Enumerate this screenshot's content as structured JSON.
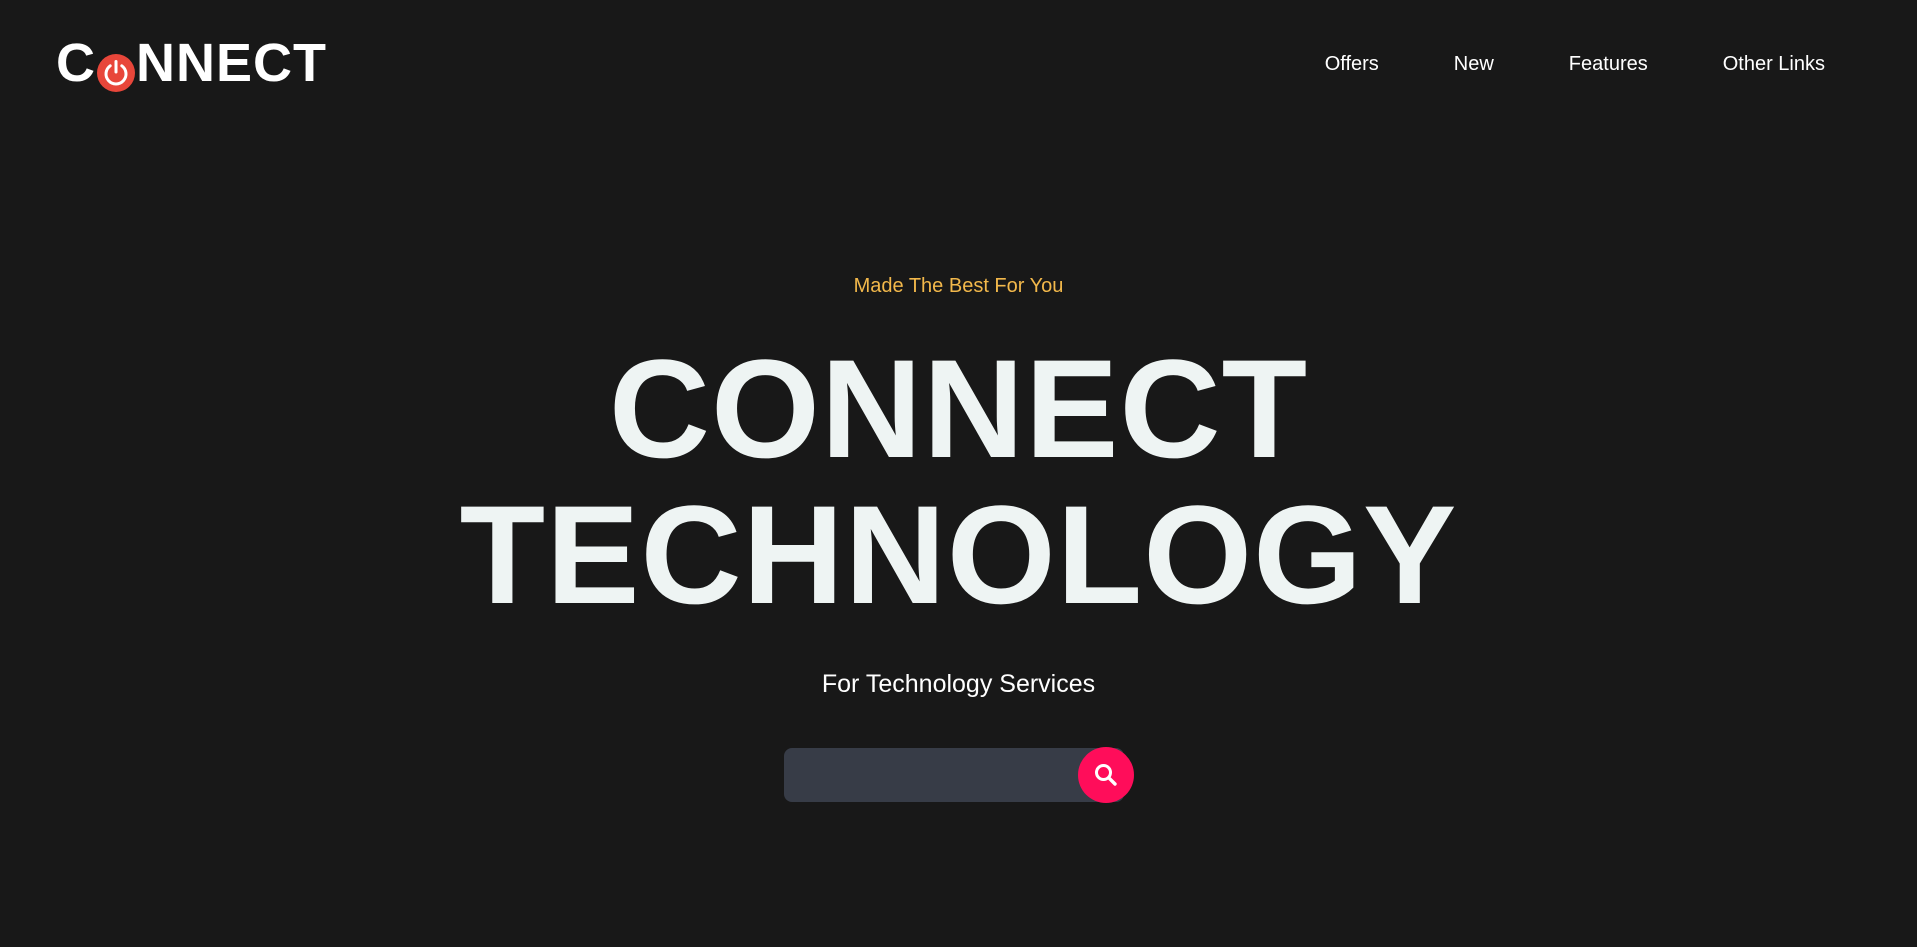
{
  "header": {
    "logo": {
      "prefix": "C",
      "suffix": "NNECT",
      "icon": "power-icon",
      "icon_color": "#e8463a"
    },
    "nav": [
      {
        "label": "Offers"
      },
      {
        "label": "New"
      },
      {
        "label": "Features"
      },
      {
        "label": "Other Links"
      }
    ]
  },
  "hero": {
    "tagline": "Made The Best For You",
    "headline_line1": "CONNECT",
    "headline_line2": "TECHNOLOGY",
    "subtitle": "For Technology Services"
  },
  "search": {
    "value": "",
    "placeholder": "",
    "button_icon": "search-icon"
  },
  "colors": {
    "background": "#181818",
    "accent": "#ff0d5a",
    "tagline": "#f2b84b",
    "headline": "#eef4f3",
    "search_field": "#373c47"
  }
}
